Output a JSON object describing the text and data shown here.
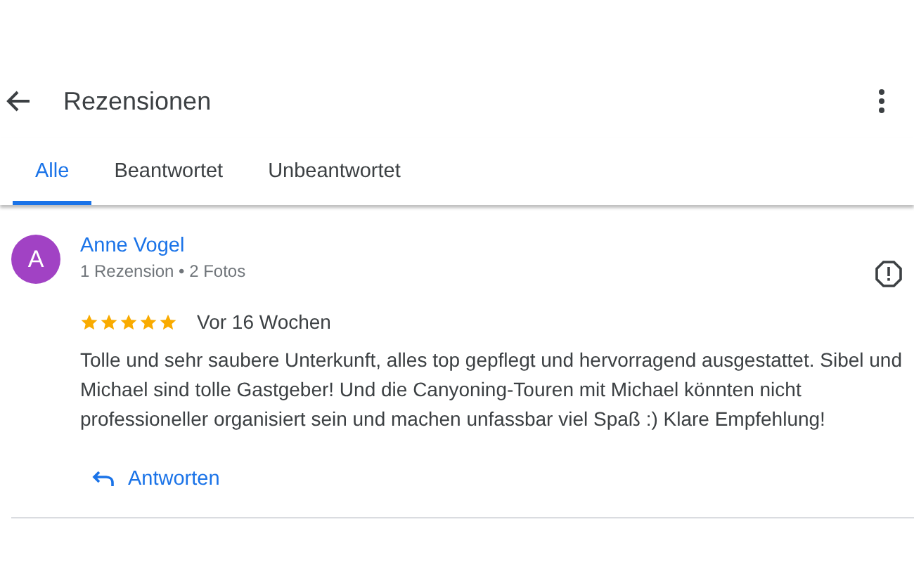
{
  "header": {
    "title": "Rezensionen"
  },
  "tabs": [
    {
      "label": "Alle",
      "selected": true
    },
    {
      "label": "Beantwortet",
      "selected": false
    },
    {
      "label": "Unbeantwortet",
      "selected": false
    }
  ],
  "reviews": [
    {
      "avatar_letter": "A",
      "name": "Anne Vogel",
      "meta": "1 Rezension • 2 Fotos",
      "stars": 5,
      "time": "Vor 16 Wochen",
      "text": "Tolle und sehr saubere Unterkunft, alles top gepflegt und hervorragend ausgestattet. Sibel und Michael sind tolle Gastgeber! Und die Canyoning-Touren mit Michael könnten nicht professioneller organisiert sein und machen unfassbar viel Spaß :) Klare Empfehlung!",
      "reply_label": "Antworten"
    }
  ]
}
